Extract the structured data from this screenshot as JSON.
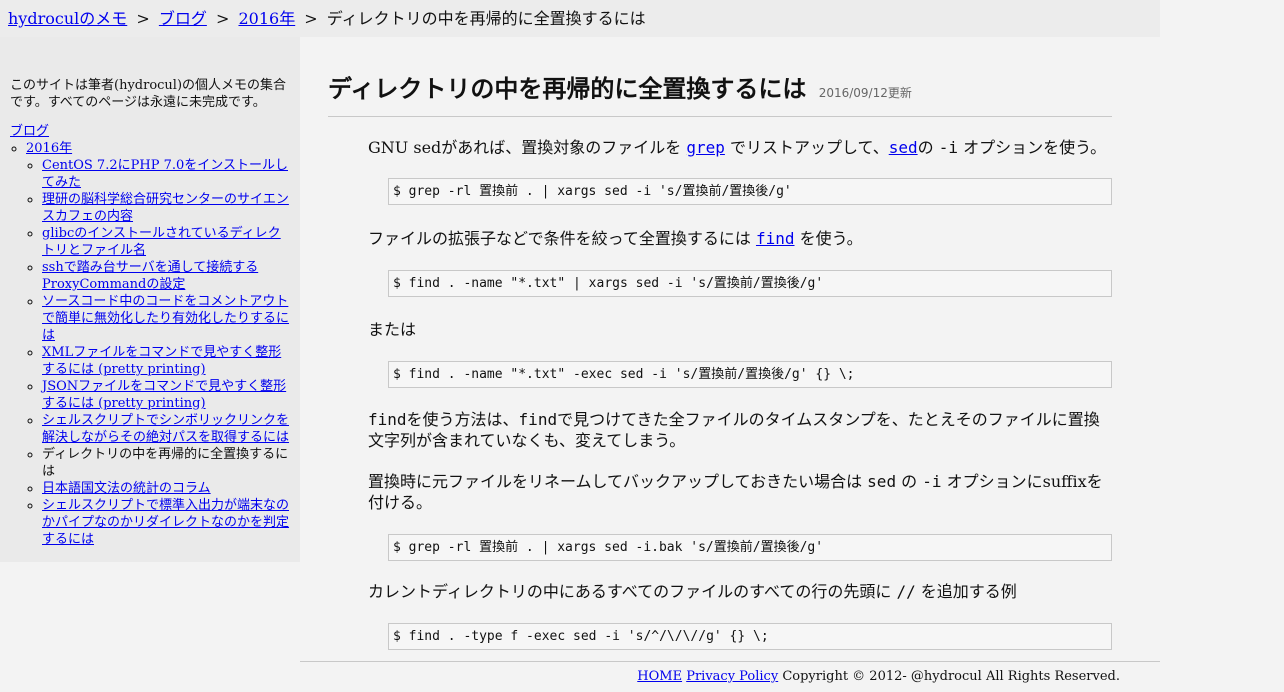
{
  "breadcrumb": {
    "site": "hydroculのメモ",
    "sep": ">",
    "blog": "ブログ",
    "year": "2016年",
    "current": "ディレクトリの中を再帰的に全置換するには"
  },
  "sidebar": {
    "intro": "このサイトは筆者(hydrocul)の個人メモの集合です。すべてのページは永遠に未完成です。",
    "blog_link": "ブログ",
    "year_link": "2016年",
    "articles": [
      "CentOS 7.2にPHP 7.0をインストールしてみた",
      "理研の脳科学総合研究センターのサイエンスカフェの内容",
      "glibcのインストールされているディレクトリとファイル名",
      "sshで踏み台サーバを通して接続するProxyCommandの設定",
      "ソースコード中のコードをコメントアウトで簡単に無効化したり有効化したりするには",
      "XMLファイルをコマンドで見やすく整形するには (pretty printing)",
      "JSONファイルをコマンドで見やすく整形するには (pretty printing)",
      "シェルスクリプトでシンボリックリンクを解決しながらその絶対パスを取得するには",
      "ディレクトリの中を再帰的に全置換するには",
      "日本語国文法の統計のコラム",
      "シェルスクリプトで標準入出力が端末なのかパイプなのかリダイレクトなのかを判定するには"
    ]
  },
  "article": {
    "title": "ディレクトリの中を再帰的に全置換するには",
    "updated": "2016/09/12更新",
    "p1_a": "GNU sedがあれば、置換対象のファイルを ",
    "p1_grep": "grep",
    "p1_b": " でリストアップして、",
    "p1_sed": "sed",
    "p1_c": "の ",
    "p1_opt": "-i",
    "p1_d": " オプションを使う。",
    "code1": "$ grep -rl 置換前 . | xargs sed -i 's/置換前/置換後/g'",
    "p2_a": "ファイルの拡張子などで条件を絞って全置換するには ",
    "p2_find": "find",
    "p2_b": " を使う。",
    "code2": "$ find . -name \"*.txt\" | xargs sed -i 's/置換前/置換後/g'",
    "p3": "または",
    "code3": "$ find . -name \"*.txt\" -exec sed -i 's/置換前/置換後/g' {} \\;",
    "p4_find1": "find",
    "p4_a": "を使う方法は、",
    "p4_find2": "find",
    "p4_b": "で見つけてきた全ファイルのタイムスタンプを、たとえそのファイルに置換文字列が含まれていなくも、変えてしまう。",
    "p5_a": "置換時に元ファイルをリネームしてバックアップしておきたい場合は ",
    "p5_sed": "sed",
    "p5_b": " の ",
    "p5_opt": "-i",
    "p5_c": " オプションにsuffixを付ける。",
    "code4": "$ grep -rl 置換前 . | xargs sed -i.bak 's/置換前/置換後/g'",
    "p6_a": "カレントディレクトリの中にあるすべてのファイルのすべての行の先頭に ",
    "p6_code": "//",
    "p6_b": " を追加する例",
    "code5": "$ find . -type f -exec sed -i 's/^/\\/\\//g' {} \\;"
  },
  "footer": {
    "home": "HOME",
    "privacy": "Privacy Policy",
    "copyright": "Copyright © 2012- @hydrocul All Rights Reserved."
  }
}
